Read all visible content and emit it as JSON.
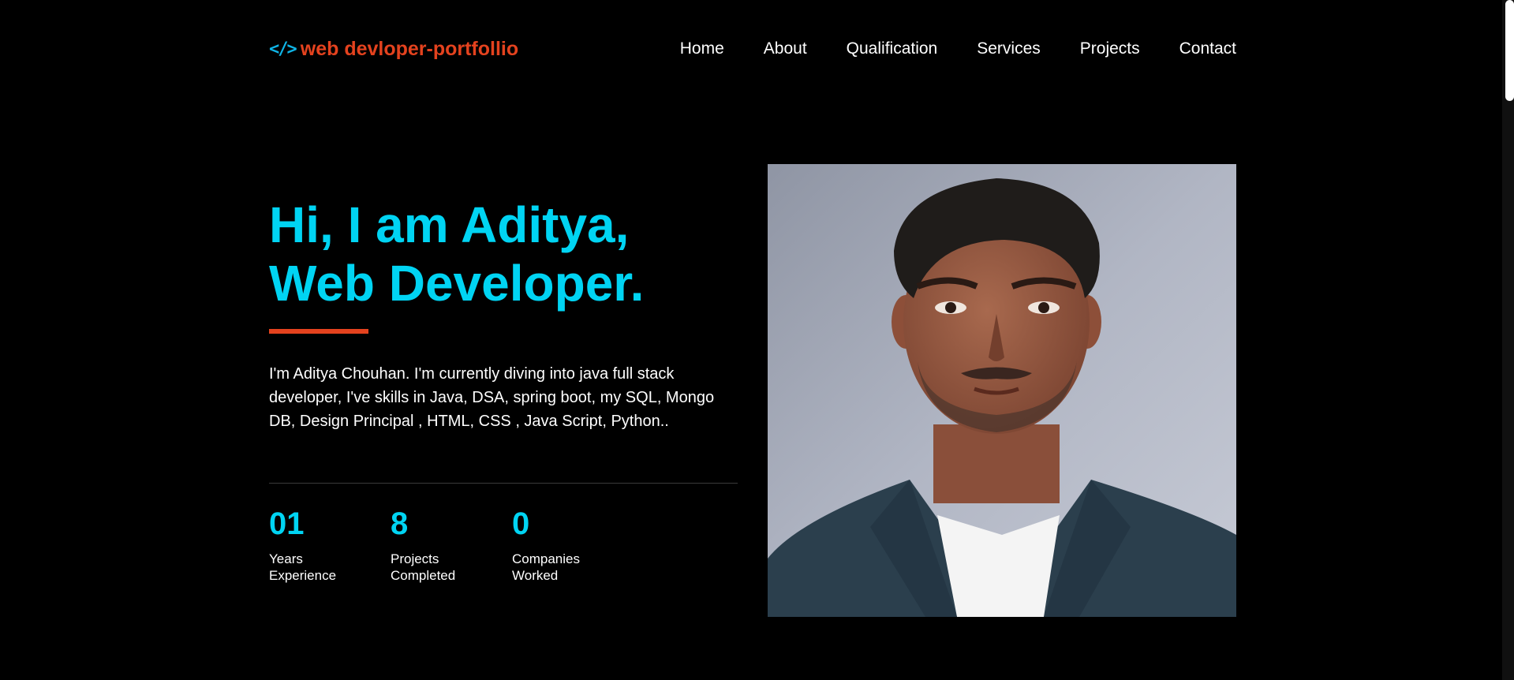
{
  "header": {
    "logo_icon": "code-icon",
    "logo_icon_glyph": "</>",
    "logo_text": "web devloper-portfollio",
    "nav": [
      "Home",
      "About",
      "Qualification",
      "Services",
      "Projects",
      "Contact"
    ]
  },
  "hero": {
    "title_line1": "Hi, I am Aditya,",
    "title_line2": "Web Developer.",
    "intro": "I'm Aditya Chouhan. I'm currently diving into java full stack developer, I've skills in Java, DSA, spring boot, my SQL, Mongo DB, Design Principal , HTML, CSS , Java Script, Python..",
    "stats": [
      {
        "value": "01",
        "label_line1": "Years",
        "label_line2": "Experience"
      },
      {
        "value": "8",
        "label_line1": "Projects",
        "label_line2": "Completed"
      },
      {
        "value": "0",
        "label_line1": "Companies",
        "label_line2": "Worked"
      }
    ]
  },
  "colors": {
    "background": "#000000",
    "accent_cyan": "#00d4f3",
    "accent_orange": "#e4421e",
    "text": "#ffffff"
  }
}
